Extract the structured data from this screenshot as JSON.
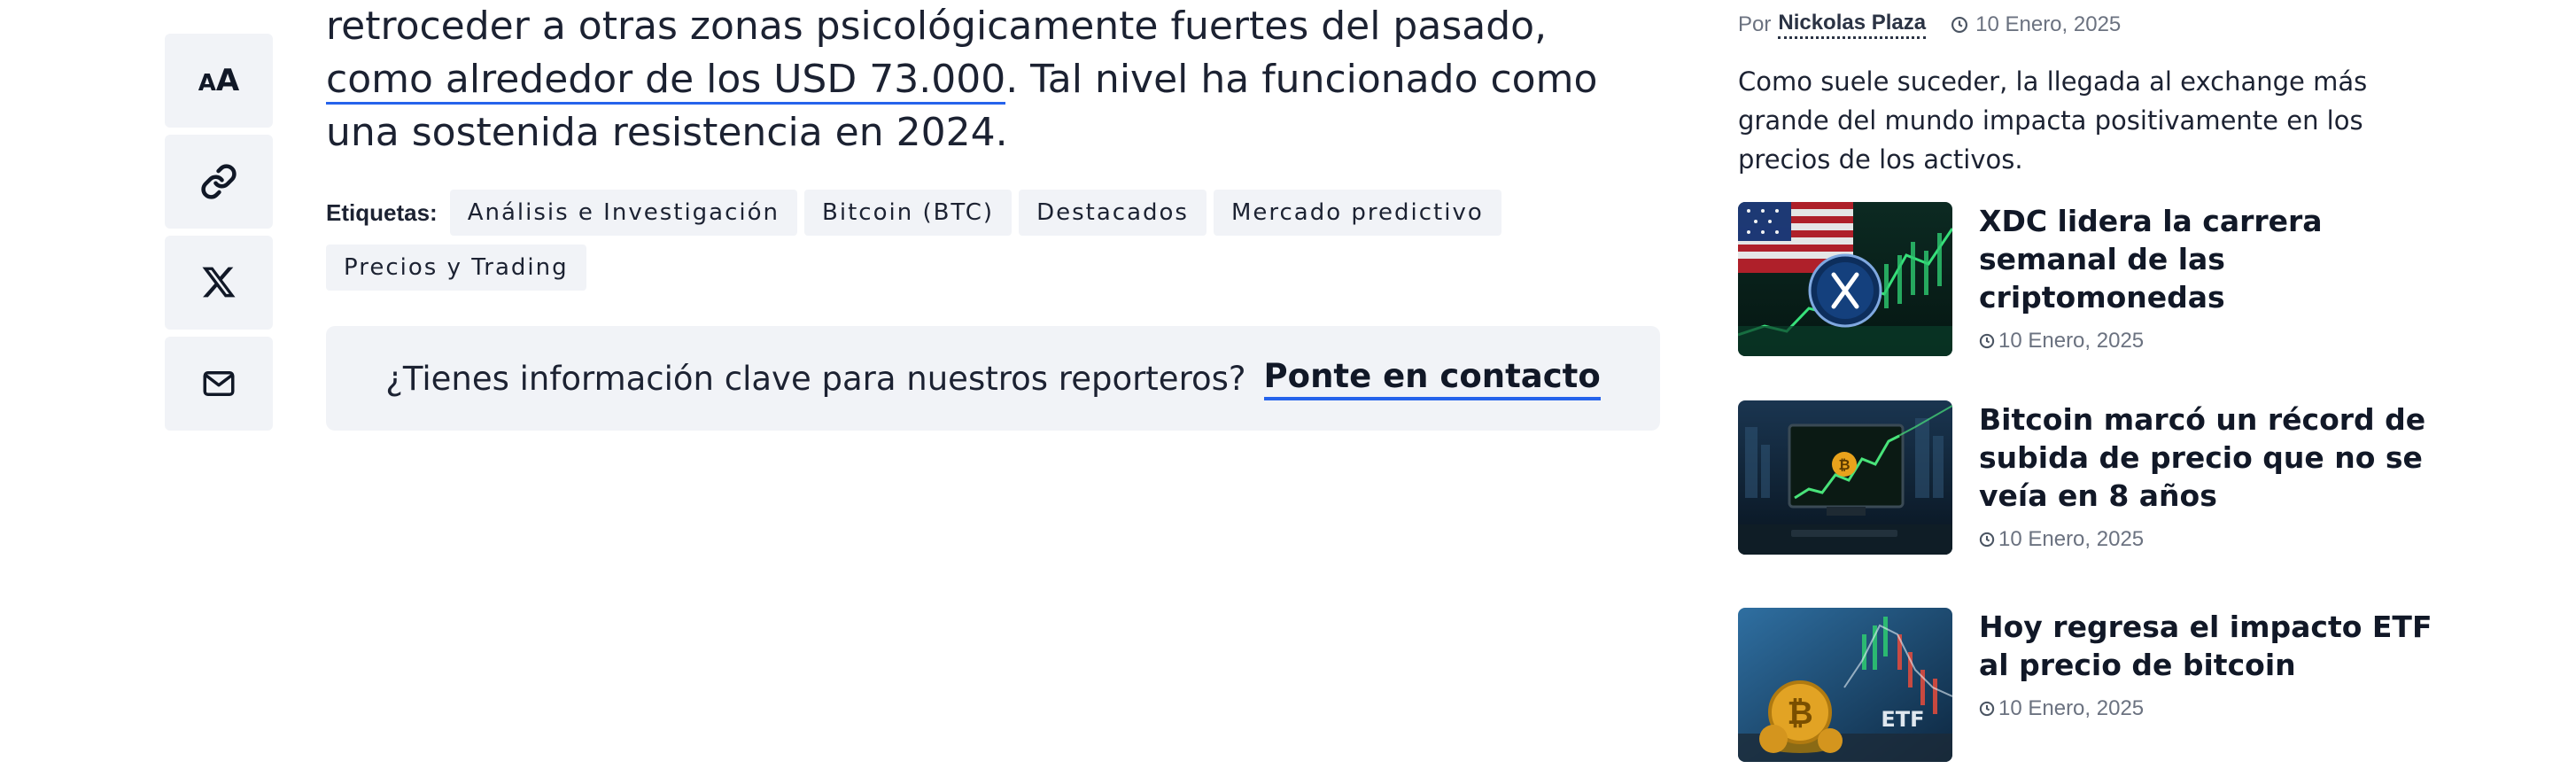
{
  "share": {
    "font_toggle_small": "A",
    "font_toggle_big": "A",
    "icons": [
      "font-size-icon",
      "link-icon",
      "x-logo-icon",
      "mail-icon"
    ]
  },
  "article": {
    "text_before_link": "retroceder a otras zonas psicológicamente fuertes del pasado, ",
    "link_text": "como alrededor de los USD 73.000",
    "text_after_link": ". Tal nivel ha funcionado como una sostenida resistencia en 2024.",
    "tags_label": "Etiquetas:",
    "tags": [
      "Análisis e Investigación",
      "Bitcoin (BTC)",
      "Destacados",
      "Mercado predictivo",
      "Precios y Trading"
    ],
    "contact_question": "¿Tienes información clave para nuestros reporteros?",
    "contact_cta": "Ponte en contacto"
  },
  "sidebar": {
    "by_label": "Por",
    "author": "Nickolas Plaza",
    "date": "10 Enero, 2025",
    "excerpt": "Como suele suceder, la llegada al exchange más grande del mundo impacta positivamente en los precios de los activos.",
    "news": [
      {
        "title": "XDC lidera la carrera semanal de las criptomonedas",
        "date": "10 Enero, 2025",
        "image": "xdc-flag-chart-image"
      },
      {
        "title": "Bitcoin marcó un récord de subida de precio que no se veía en 8 años",
        "date": "10 Enero, 2025",
        "image": "bitcoin-monitor-chart-image"
      },
      {
        "title": "Hoy regresa el impacto ETF al precio de bitcoin",
        "date": "10 Enero, 2025",
        "image": "bitcoin-etf-coins-image",
        "image_text": "ETF"
      }
    ]
  },
  "colors": {
    "accent": "#2563eb",
    "text": "#1c2232",
    "muted": "#6b7280",
    "chip_bg": "#f1f3f7"
  }
}
